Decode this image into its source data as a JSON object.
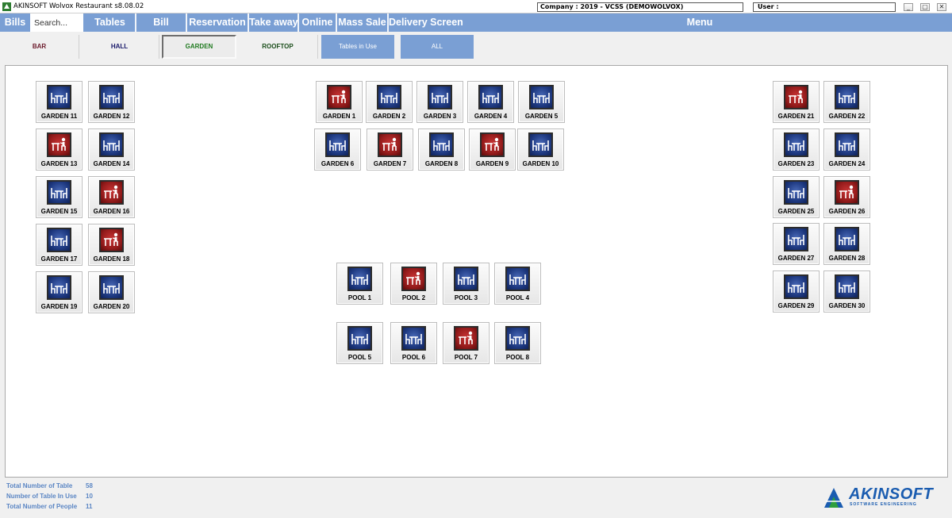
{
  "window": {
    "title": "AKINSOFT Wolvox Restaurant s8.08.02",
    "company": "Company : 2019 - VCSS (DEMOWOLVOX)",
    "user": "User :",
    "buttons": {
      "minimize": "_",
      "restore": "▢",
      "close": "✕"
    }
  },
  "menu": {
    "bills": "Bills",
    "search_placeholder": "Search...",
    "tables": "Tables",
    "bill": "Bill",
    "reservation": "Reservation",
    "take_away": "Take away",
    "online": "Online",
    "mass_sale": "Mass Sale",
    "delivery_screen": "Delivery Screen",
    "menu": "Menu"
  },
  "areas": {
    "bar": "BAR",
    "hall": "HALL",
    "garden": "GARDEN",
    "rooftop": "ROOFTOP",
    "tables_in_use": "Tables in Use",
    "all": "ALL",
    "selected": "GARDEN"
  },
  "status_colors": {
    "free": "#1f3a82",
    "occupied": "#961c1c"
  },
  "tables": [
    {
      "name": "GARDEN 11",
      "status": "free"
    },
    {
      "name": "GARDEN 12",
      "status": "free"
    },
    {
      "name": "GARDEN 13",
      "status": "occupied"
    },
    {
      "name": "GARDEN 14",
      "status": "free"
    },
    {
      "name": "GARDEN 15",
      "status": "free"
    },
    {
      "name": "GARDEN 16",
      "status": "occupied"
    },
    {
      "name": "GARDEN 17",
      "status": "free"
    },
    {
      "name": "GARDEN 18",
      "status": "occupied"
    },
    {
      "name": "GARDEN 19",
      "status": "free"
    },
    {
      "name": "GARDEN 20",
      "status": "free"
    },
    {
      "name": "GARDEN 1",
      "status": "occupied"
    },
    {
      "name": "GARDEN 2",
      "status": "free"
    },
    {
      "name": "GARDEN 3",
      "status": "free"
    },
    {
      "name": "GARDEN 4",
      "status": "free"
    },
    {
      "name": "GARDEN 5",
      "status": "free"
    },
    {
      "name": "GARDEN 6",
      "status": "free"
    },
    {
      "name": "GARDEN 7",
      "status": "occupied"
    },
    {
      "name": "GARDEN 8",
      "status": "free"
    },
    {
      "name": "GARDEN 9",
      "status": "occupied"
    },
    {
      "name": "GARDEN 10",
      "status": "free"
    },
    {
      "name": "GARDEN 21",
      "status": "occupied"
    },
    {
      "name": "GARDEN 22",
      "status": "free"
    },
    {
      "name": "GARDEN 23",
      "status": "free"
    },
    {
      "name": "GARDEN 24",
      "status": "free"
    },
    {
      "name": "GARDEN 25",
      "status": "free"
    },
    {
      "name": "GARDEN 26",
      "status": "occupied"
    },
    {
      "name": "GARDEN 27",
      "status": "free"
    },
    {
      "name": "GARDEN 28",
      "status": "free"
    },
    {
      "name": "GARDEN 29",
      "status": "free"
    },
    {
      "name": "GARDEN 30",
      "status": "free"
    },
    {
      "name": "POOL 1",
      "status": "free"
    },
    {
      "name": "POOL 2",
      "status": "occupied"
    },
    {
      "name": "POOL 3",
      "status": "free"
    },
    {
      "name": "POOL 4",
      "status": "free"
    },
    {
      "name": "POOL 5",
      "status": "free"
    },
    {
      "name": "POOL 6",
      "status": "free"
    },
    {
      "name": "POOL 7",
      "status": "occupied"
    },
    {
      "name": "POOL 8",
      "status": "free"
    }
  ],
  "stats": {
    "total_tables_label": "Total Number of Table",
    "total_tables_value": "58",
    "tables_in_use_label": "Number of Table In Use",
    "tables_in_use_value": "10",
    "total_people_label": "Total Number of People",
    "total_people_value": "11"
  },
  "logo": {
    "name": "AKINSOFT",
    "tagline": "SOFTWARE ENGINEERING"
  }
}
